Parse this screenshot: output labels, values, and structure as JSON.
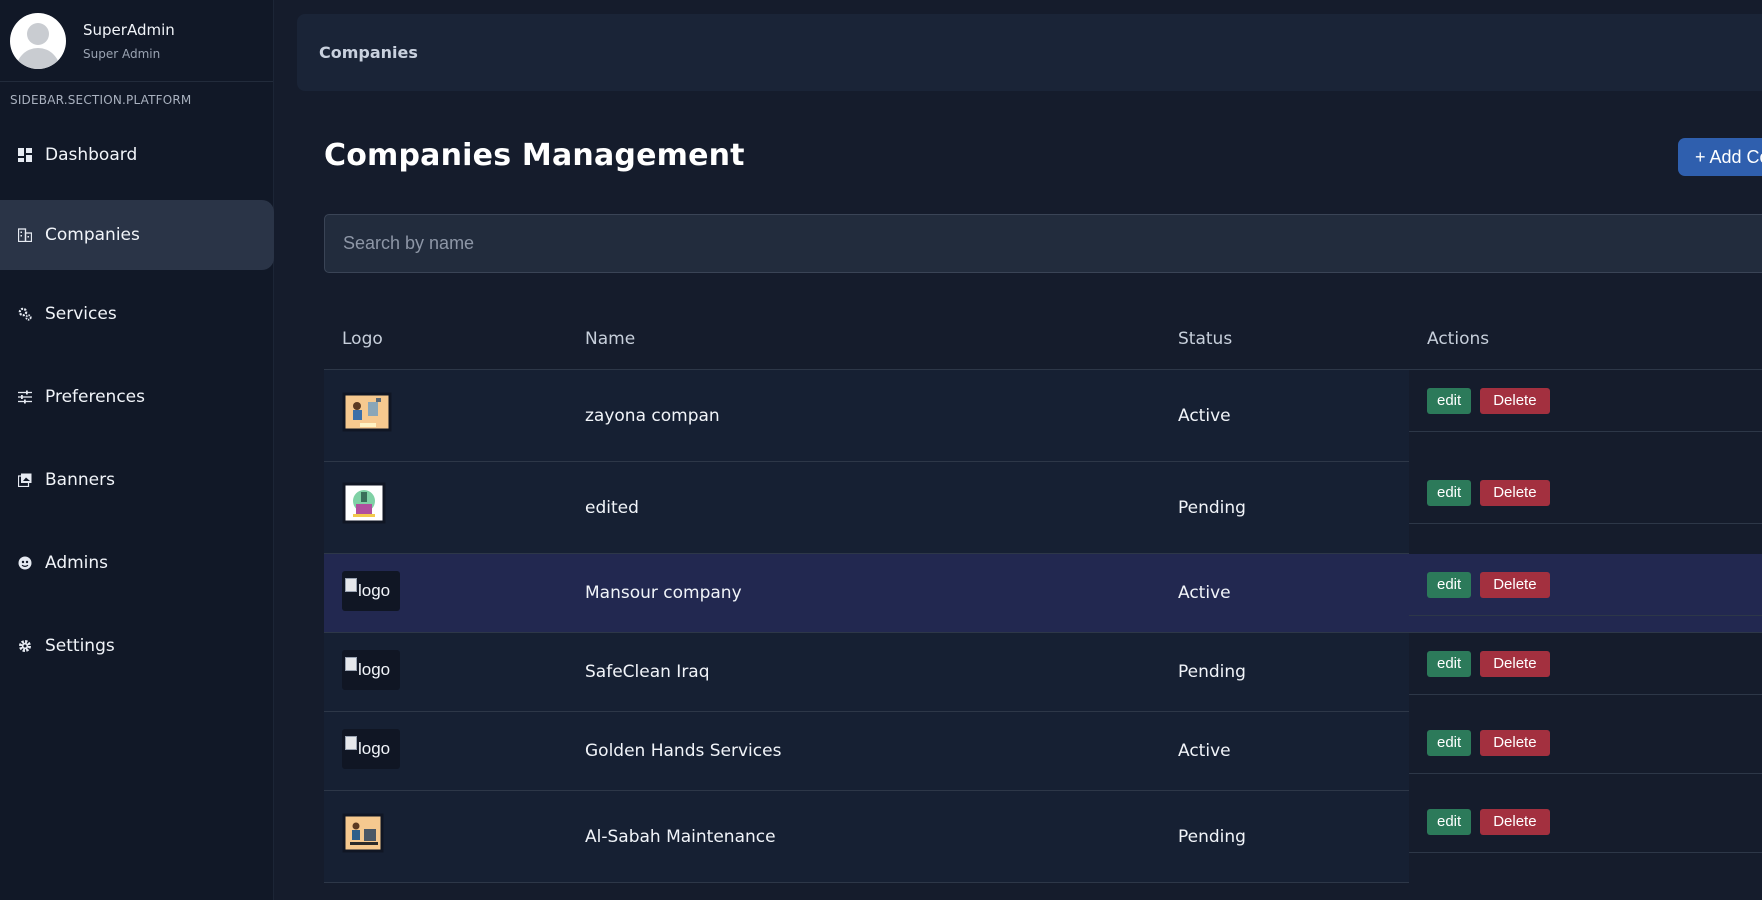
{
  "profile": {
    "name": "SuperAdmin",
    "role": "Super Admin"
  },
  "sidebar": {
    "section_title": "SIDEBAR.SECTION.PLATFORM",
    "items": [
      {
        "label": "Dashboard",
        "icon": "dashboard-icon",
        "active": false
      },
      {
        "label": "Companies",
        "icon": "building-icon",
        "active": true
      },
      {
        "label": "Services",
        "icon": "gears-icon",
        "active": false
      },
      {
        "label": "Preferences",
        "icon": "sliders-icon",
        "active": false
      },
      {
        "label": "Banners",
        "icon": "images-icon",
        "active": false
      },
      {
        "label": "Admins",
        "icon": "user-circle-icon",
        "active": false
      },
      {
        "label": "Settings",
        "icon": "gear-icon",
        "active": false
      }
    ]
  },
  "header": {
    "breadcrumb": "Companies"
  },
  "main": {
    "title": "Companies Management",
    "add_button_label": "+ Add Company",
    "search_placeholder": "Search by name",
    "columns": {
      "logo": "Logo",
      "name": "Name",
      "status": "Status",
      "actions": "Actions"
    },
    "edit_label": "edit",
    "delete_label": "Delete",
    "logo_alt": "logo",
    "rows": [
      {
        "logo": "plumbing-logo-image",
        "name": "zayona compan",
        "status": "Active"
      },
      {
        "logo": "cleaning-logo-image",
        "name": "edited",
        "status": "Pending"
      },
      {
        "logo": "broken-image",
        "name": "Mansour company",
        "status": "Active"
      },
      {
        "logo": "broken-image",
        "name": "SafeClean Iraq",
        "status": "Pending"
      },
      {
        "logo": "broken-image",
        "name": "Golden Hands Services",
        "status": "Active"
      },
      {
        "logo": "repair-logo-image",
        "name": "Al-Sabah Maintenance",
        "status": "Pending"
      }
    ]
  },
  "colors": {
    "background": "#151c2c",
    "sidebar": "#111827",
    "active_item": "#2a3447",
    "primary": "#2f5fae",
    "edit": "#2c7a5a",
    "delete": "#a3303f",
    "highlight_row": "#222850"
  }
}
